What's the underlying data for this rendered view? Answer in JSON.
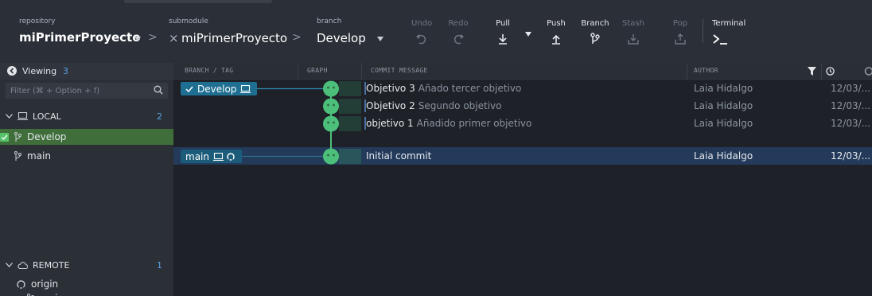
{
  "toolbar": {
    "repository_caption": "repository",
    "repository_name": "miPrimerProyecto",
    "submodule_caption": "submodule",
    "submodule_name": "miPrimerProyecto",
    "branch_caption": "branch",
    "branch_name": "Develop",
    "buttons": [
      {
        "label": "Undo",
        "icon": "undo-icon",
        "enabled": false
      },
      {
        "label": "Redo",
        "icon": "redo-icon",
        "enabled": false
      },
      {
        "label": "Pull",
        "icon": "pull-icon",
        "enabled": true
      },
      {
        "label": "Push",
        "icon": "push-icon",
        "enabled": true
      },
      {
        "label": "Branch",
        "icon": "branch-icon",
        "enabled": true
      },
      {
        "label": "Stash",
        "icon": "stash-icon",
        "enabled": false
      },
      {
        "label": "Pop",
        "icon": "pop-icon",
        "enabled": false
      },
      {
        "label": "Terminal",
        "icon": "terminal-icon",
        "enabled": true
      }
    ]
  },
  "left_panel": {
    "viewing_label": "Viewing",
    "viewing_count": "3",
    "filter_placeholder": "Filter (⌘ + Option + f)",
    "local": {
      "label": "LOCAL",
      "count": "2",
      "branches": [
        {
          "name": "Develop",
          "checked": true
        },
        {
          "name": "main",
          "checked": false
        }
      ]
    },
    "remote": {
      "label": "REMOTE",
      "count": "1",
      "origin": "origin",
      "branches": [
        {
          "name": "main"
        }
      ]
    }
  },
  "grid": {
    "columns": {
      "branch_tag": "BRANCH / TAG",
      "graph": "GRAPH",
      "commit_message": "COMMIT MESSAGE",
      "author": "AUTHOR"
    },
    "branch_labels": {
      "develop": "Develop",
      "main": "main"
    },
    "commits": [
      {
        "summary": "Objetivo 3",
        "description": "Añado tercer objetivo",
        "author": "Laia Hidalgo",
        "date": "12/03/...",
        "selected": false
      },
      {
        "summary": "Objetivo 2",
        "description": "Segundo objetivo",
        "author": "Laia Hidalgo",
        "date": "12/03/...",
        "selected": false
      },
      {
        "summary": "objetivo 1",
        "description": "Añadido primer objetivo",
        "author": "Laia Hidalgo",
        "date": "12/03/...",
        "selected": false
      },
      {
        "summary": "Initial commit",
        "description": "",
        "author": "Laia Hidalgo",
        "date": "12/03/...",
        "selected": true
      }
    ]
  },
  "colors": {
    "accent_blue": "#5aa0e6",
    "graph_green": "#4cc07a",
    "selected_row": "#233a5a",
    "checked_branch": "#3f6e3a",
    "branch_label": "#1f6f92"
  }
}
